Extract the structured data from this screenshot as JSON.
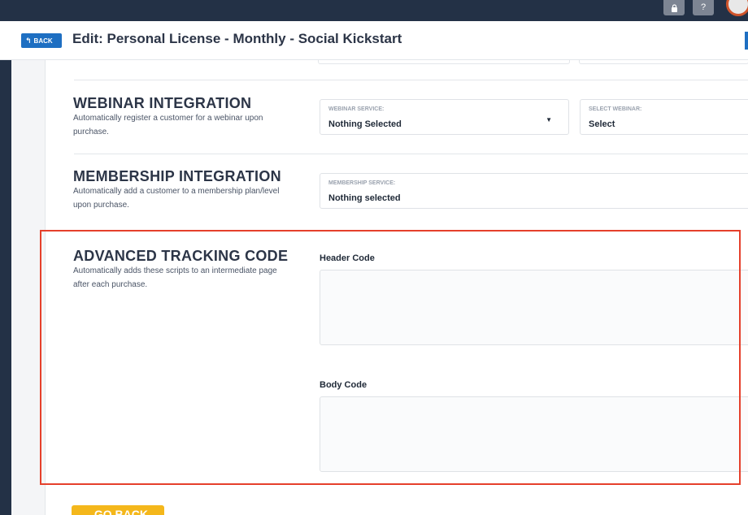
{
  "topbar": {
    "lock_icon": "lock-icon",
    "help_label": "?",
    "avatar_icon": "avatar"
  },
  "header": {
    "back_label": "BACK",
    "back_icon": "↰",
    "title": "Edit: Personal License - Monthly - Social Kickstart"
  },
  "webinar": {
    "title": "WEBINAR INTEGRATION",
    "description": "Automatically register a customer for a webinar upon purchase.",
    "service_label": "WEBINAR SERVICE:",
    "service_value": "Nothing Selected",
    "select_label": "SELECT WEBINAR:",
    "select_value": "Select"
  },
  "membership": {
    "title": "MEMBERSHIP INTEGRATION",
    "description": "Automatically add a customer to a membership plan/level upon purchase.",
    "service_label": "MEMBERSHIP SERVICE:",
    "service_value": "Nothing selected"
  },
  "tracking": {
    "title": "ADVANCED TRACKING CODE",
    "description": "Automatically adds these scripts to an intermediate page after each purchase.",
    "header_code_label": "Header Code",
    "header_code_value": "",
    "body_code_label": "Body Code",
    "body_code_value": ""
  },
  "footer": {
    "go_back_label": "← GO BACK"
  },
  "colors": {
    "nav_dark": "#233146",
    "back_blue": "#1e6fc2",
    "highlight_red": "#e5402b",
    "go_back_yellow": "#f4b71b"
  }
}
